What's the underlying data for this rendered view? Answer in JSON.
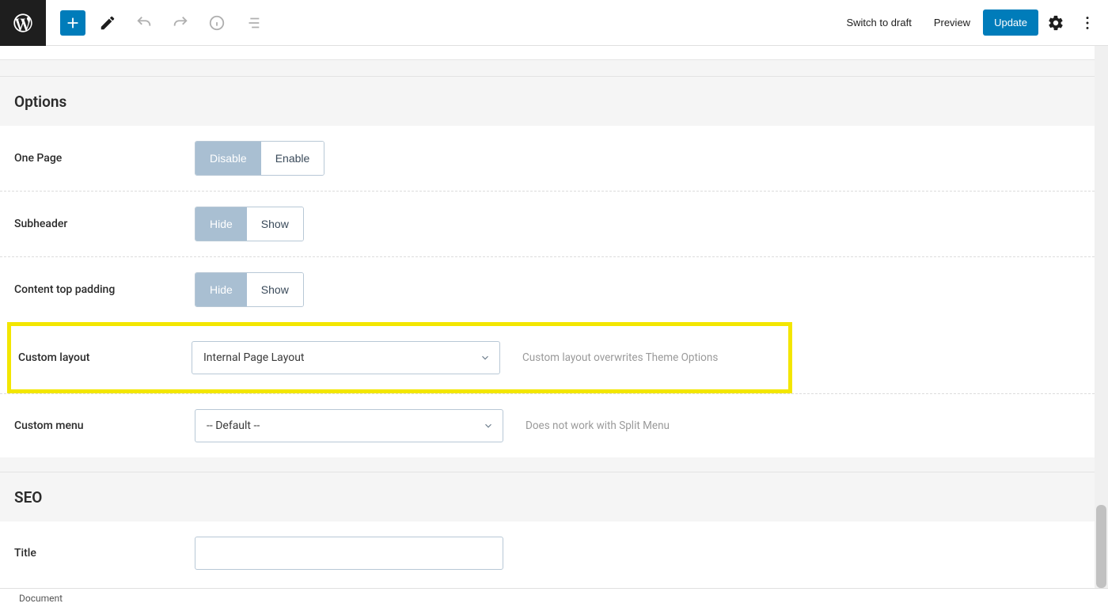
{
  "topbar": {
    "switch_to_draft": "Switch to draft",
    "preview": "Preview",
    "update": "Update"
  },
  "sections": {
    "options_title": "Options",
    "seo_title": "SEO"
  },
  "rows": {
    "one_page": {
      "label": "One Page",
      "disable": "Disable",
      "enable": "Enable"
    },
    "subheader": {
      "label": "Subheader",
      "hide": "Hide",
      "show": "Show"
    },
    "content_top_padding": {
      "label": "Content top padding",
      "hide": "Hide",
      "show": "Show"
    },
    "custom_layout": {
      "label": "Custom layout",
      "selected": "Internal Page Layout",
      "hint": "Custom layout overwrites Theme Options"
    },
    "custom_menu": {
      "label": "Custom menu",
      "selected": "-- Default --",
      "hint": "Does not work with Split Menu"
    },
    "title": {
      "label": "Title",
      "value": ""
    }
  },
  "footer": {
    "breadcrumb": "Document"
  },
  "colors": {
    "primary": "#007cba",
    "segmented_active": "#a9bfd2",
    "highlight": "#f3e600"
  }
}
